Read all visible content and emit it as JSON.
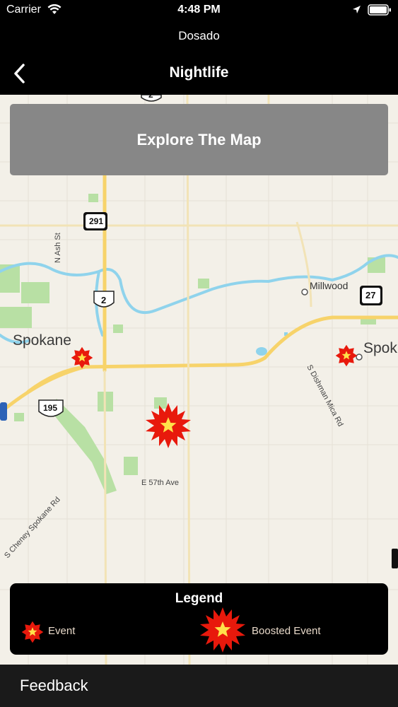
{
  "status_bar": {
    "carrier": "Carrier",
    "time": "4:48 PM"
  },
  "nav": {
    "subtitle": "Dosado",
    "title": "Nightlife"
  },
  "explore_button": {
    "label": "Explore The Map"
  },
  "map": {
    "labels": {
      "spokane": "Spokane",
      "spokane_valley": "Spok",
      "millwood": "Millwood",
      "n_ash_st": "N Ash St",
      "e_57th_ave": "E 57th Ave",
      "s_cheney_spokane_rd": "S Cheney Spokane Rd",
      "s_dishman_mica_rd": "S Dishman Mica Rd"
    },
    "shields": {
      "route_291": "291",
      "route_2_top": "2",
      "route_2": "2",
      "route_195": "195",
      "route_27": "27"
    }
  },
  "legend": {
    "title": "Legend",
    "event_label": "Event",
    "boosted_label": "Boosted Event"
  },
  "footer": {
    "feedback_label": "Feedback"
  },
  "colors": {
    "marker_red": "#e8190c",
    "marker_star": "#ffe14a",
    "explore_bg": "#878787",
    "map_bg": "#f3f0e8",
    "water": "#8fd3ec",
    "park": "#b8e0a4",
    "highway": "#f7d36a"
  }
}
